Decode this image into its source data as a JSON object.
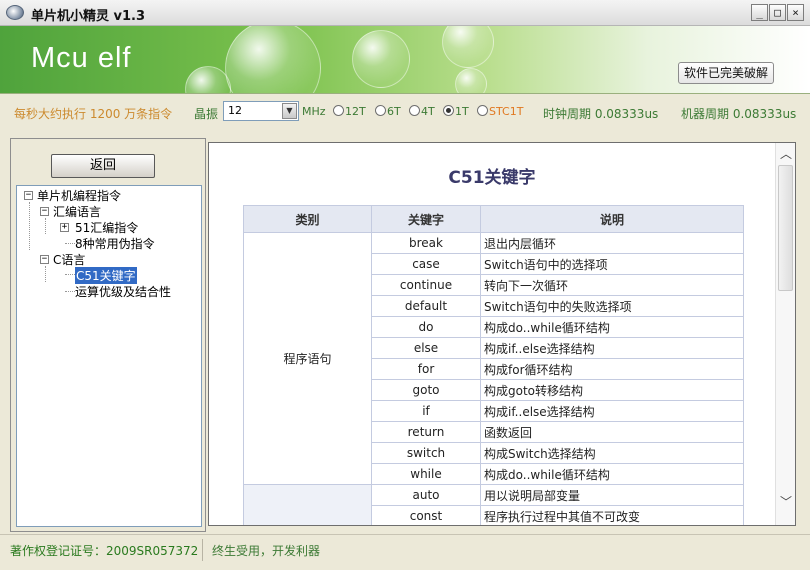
{
  "window": {
    "title": "单片机小精灵  v1.3",
    "minimize": "_",
    "maximize": "□",
    "close": "×"
  },
  "banner": {
    "logo": "Mcu elf",
    "crack_button": "软件已完美破解"
  },
  "info": {
    "performance": "每秒大约执行 1200 万条指令",
    "crystal_label": "晶振",
    "crystal_value": "12",
    "mhz": "MHz",
    "modes": [
      {
        "label": "12T",
        "selected": false
      },
      {
        "label": "6T",
        "selected": false
      },
      {
        "label": "4T",
        "selected": false
      },
      {
        "label": "1T",
        "selected": true
      },
      {
        "label": "STC1T",
        "selected": false
      }
    ],
    "clock_period": "时钟周期 0.08333us",
    "machine_period": "机器周期 0.08333us"
  },
  "sidebar": {
    "back_button": "返回",
    "tree": {
      "root": "单片机编程指令",
      "asm": "汇编语言",
      "asm_51": "51汇编指令",
      "asm_pseudo": "8种常用伪指令",
      "c": "C语言",
      "c_keywords": "C51关键字",
      "c_precedence": "运算优级及结合性"
    }
  },
  "content": {
    "title": "C51关键字",
    "headers": [
      "类别",
      "关键字",
      "说明"
    ],
    "category_1": "程序语句",
    "rows": [
      {
        "kw": "break",
        "desc": "退出内层循环"
      },
      {
        "kw": "case",
        "desc": "Switch语句中的选择项"
      },
      {
        "kw": "continue",
        "desc": "转向下一次循环"
      },
      {
        "kw": "default",
        "desc": "Switch语句中的失败选择项"
      },
      {
        "kw": "do",
        "desc": "构成do..while循环结构"
      },
      {
        "kw": "else",
        "desc": "构成if..else选择结构"
      },
      {
        "kw": "for",
        "desc": "构成for循环结构"
      },
      {
        "kw": "goto",
        "desc": "构成goto转移结构"
      },
      {
        "kw": "if",
        "desc": "构成if..else选择结构"
      },
      {
        "kw": "return",
        "desc": "函数返回"
      },
      {
        "kw": "switch",
        "desc": "构成Switch选择结构"
      },
      {
        "kw": "while",
        "desc": "构成do..while循环结构"
      },
      {
        "kw": "auto",
        "desc": "用以说明局部变量"
      },
      {
        "kw": "const",
        "desc": "程序执行过程中其值不可改变"
      }
    ]
  },
  "statusbar": {
    "copyright": "著作权登记证号：2009SR057372",
    "slogan": "终生受用，开发利器"
  }
}
